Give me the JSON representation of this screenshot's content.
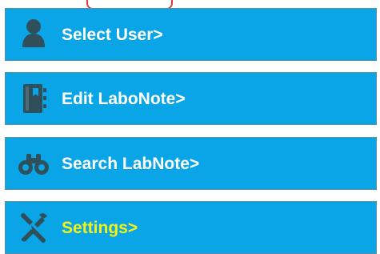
{
  "menu": {
    "items": [
      {
        "label": "Select User>",
        "icon": "user-icon"
      },
      {
        "label": "Edit LaboNote>",
        "icon": "notebook-icon"
      },
      {
        "label": "Search LabNote>",
        "icon": "binoculars-icon"
      },
      {
        "label": "Settings>",
        "icon": "tools-icon"
      }
    ]
  },
  "colors": {
    "menu_background": "#0aa5e6",
    "menu_border": "#5f8fa5",
    "label_text": "#ffffff",
    "active_label_text": "#f3f316",
    "icon_color": "#2f4f5b",
    "top_tab_border": "#e23a3a"
  }
}
